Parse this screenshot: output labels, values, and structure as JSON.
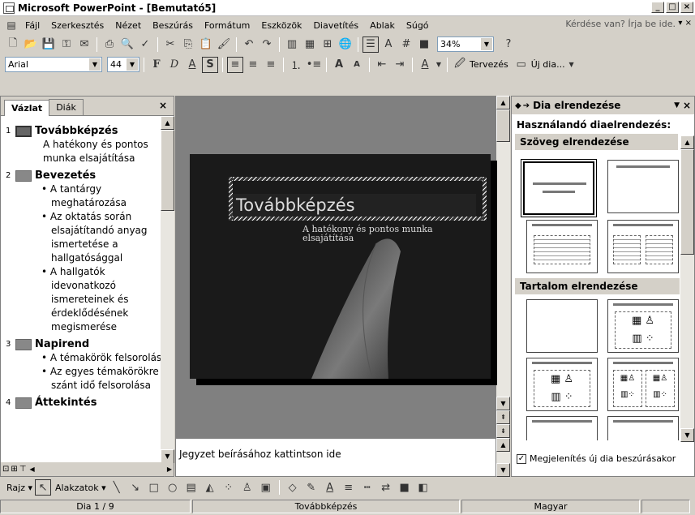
{
  "window": {
    "title": "Microsoft PowerPoint - [Bemutató5]"
  },
  "menu": {
    "items": [
      "Fájl",
      "Szerkesztés",
      "Nézet",
      "Beszúrás",
      "Formátum",
      "Eszközök",
      "Diavetítés",
      "Ablak",
      "Súgó"
    ],
    "ask_placeholder": "Kérdése van? Írja be ide."
  },
  "toolbar": {
    "zoom": "34%"
  },
  "format_toolbar": {
    "font": "Arial",
    "size": "44",
    "design_label": "Tervezés",
    "new_slide_label": "Új dia..."
  },
  "left_panel": {
    "tabs": [
      "Vázlat",
      "Diák"
    ],
    "slides": [
      {
        "num": "1",
        "title": "Továbbképzés",
        "sub": [
          "A hatékony és pontos",
          "munka elsajátítása"
        ]
      },
      {
        "num": "2",
        "title": "Bevezetés",
        "bullets": [
          "A tantárgy meghatározása",
          "Az oktatás során elsajátítandó anyag ismertetése a hallgatósággal",
          "A hallgatók idevonatkozó ismereteinek és érdeklődésének megismerése"
        ]
      },
      {
        "num": "3",
        "title": "Napirend",
        "bullets": [
          "A témakörök felsorolása",
          "Az egyes témakörökre szánt idő felsorolása"
        ]
      },
      {
        "num": "4",
        "title": "Áttekintés"
      }
    ]
  },
  "slide": {
    "title": "Továbbképzés",
    "subtitle": "A hatékony és pontos munka elsajátítása"
  },
  "notes": {
    "placeholder": "Jegyzet beírásához kattintson ide"
  },
  "taskpane": {
    "title": "Dia elrendezése",
    "subtitle": "Használandó diaelrendezés:",
    "section_text": "Szöveg elrendezése",
    "section_content": "Tartalom elrendezése",
    "checkbox_label": "Megjelenítés új dia beszúrásakor"
  },
  "drawing": {
    "draw_label": "Rajz",
    "autoshapes_label": "Alakzatok"
  },
  "status": {
    "slide": "Dia 1 / 9",
    "design": "Továbbképzés",
    "language": "Magyar"
  }
}
